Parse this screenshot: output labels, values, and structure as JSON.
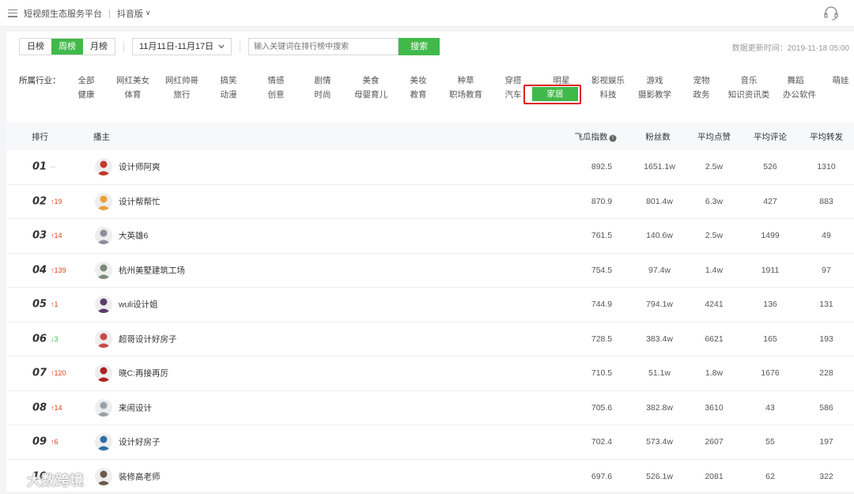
{
  "topbar": {
    "title": "短视频生态服务平台",
    "separator": "|",
    "edition": "抖音版",
    "edition_caret": "∨"
  },
  "controls": {
    "periods": [
      {
        "label": "日榜",
        "active": false
      },
      {
        "label": "周榜",
        "active": true
      },
      {
        "label": "月榜",
        "active": false
      }
    ],
    "date_range": "11月11日-11月17日",
    "search_placeholder": "输入关键词在排行榜中搜索",
    "search_button": "搜索",
    "update_time": "数据更新时间：2019-11-18 05:00"
  },
  "industries": {
    "label": "所属行业：",
    "active": "家居",
    "row1": [
      "全部",
      "网红美女",
      "网红帅哥",
      "搞笑",
      "情感",
      "剧情",
      "美食",
      "美妆",
      "种草",
      "穿搭",
      "明星",
      "影视娱乐",
      "游戏",
      "宠物",
      "音乐",
      "舞蹈",
      "萌娃"
    ],
    "row2": [
      "健康",
      "体育",
      "旅行",
      "动漫",
      "创意",
      "时尚",
      "母婴育儿",
      "教育",
      "职场教育",
      "汽车",
      "家居",
      "科技",
      "摄影教学",
      "政务",
      "知识资讯类",
      "办公软件"
    ]
  },
  "table": {
    "headers": {
      "rank": "排行",
      "host": "播主",
      "index": "飞瓜指数",
      "fans": "粉丝数",
      "likes": "平均点赞",
      "comments": "平均评论",
      "shares": "平均转发"
    },
    "rows": [
      {
        "rank": "01",
        "change": "--",
        "dir": "flat",
        "name": "设计师阿爽",
        "index": "892.5",
        "fans": "1651.1w",
        "likes": "2.5w",
        "comments": "526",
        "shares": "1310",
        "avatar_color": "#c0392b"
      },
      {
        "rank": "02",
        "change": "↑19",
        "dir": "up",
        "name": "设计帮帮忙",
        "index": "870.9",
        "fans": "801.4w",
        "likes": "6.3w",
        "comments": "427",
        "shares": "883",
        "avatar_color": "#e8a13a"
      },
      {
        "rank": "03",
        "change": "↑14",
        "dir": "up",
        "name": "大英雄6",
        "index": "761.5",
        "fans": "140.6w",
        "likes": "2.5w",
        "comments": "1499",
        "shares": "49",
        "avatar_color": "#8a8f99"
      },
      {
        "rank": "04",
        "change": "↑139",
        "dir": "up",
        "name": "杭州美墅建筑工场",
        "index": "754.5",
        "fans": "97.4w",
        "likes": "1.4w",
        "comments": "1911",
        "shares": "97",
        "avatar_color": "#7a8a7a"
      },
      {
        "rank": "05",
        "change": "↑1",
        "dir": "up",
        "name": "wuli设计姐",
        "index": "744.9",
        "fans": "794.1w",
        "likes": "4241",
        "comments": "136",
        "shares": "131",
        "avatar_color": "#5a3d6e"
      },
      {
        "rank": "06",
        "change": "↓3",
        "dir": "down",
        "name": "超哥设计好房子",
        "index": "728.5",
        "fans": "383.4w",
        "likes": "6621",
        "comments": "165",
        "shares": "193",
        "avatar_color": "#c94a4a"
      },
      {
        "rank": "07",
        "change": "↑120",
        "dir": "up",
        "name": "晓C:再接再厉",
        "index": "710.5",
        "fans": "51.1w",
        "likes": "1.8w",
        "comments": "1676",
        "shares": "228",
        "avatar_color": "#b02020"
      },
      {
        "rank": "08",
        "change": "↑14",
        "dir": "up",
        "name": "来闹设计",
        "index": "705.6",
        "fans": "382.8w",
        "likes": "3610",
        "comments": "43",
        "shares": "586",
        "avatar_color": "#9aa0a6"
      },
      {
        "rank": "09",
        "change": "↑6",
        "dir": "up",
        "name": "设计好房子",
        "index": "702.4",
        "fans": "573.4w",
        "likes": "2607",
        "comments": "55",
        "shares": "197",
        "avatar_color": "#2e6fa8"
      },
      {
        "rank": "10",
        "change": "",
        "dir": "flat",
        "name": "装修高老师",
        "index": "697.6",
        "fans": "526.1w",
        "likes": "2081",
        "comments": "62",
        "shares": "322",
        "avatar_color": "#6b5a4a"
      }
    ]
  },
  "watermark": "大数跨境"
}
